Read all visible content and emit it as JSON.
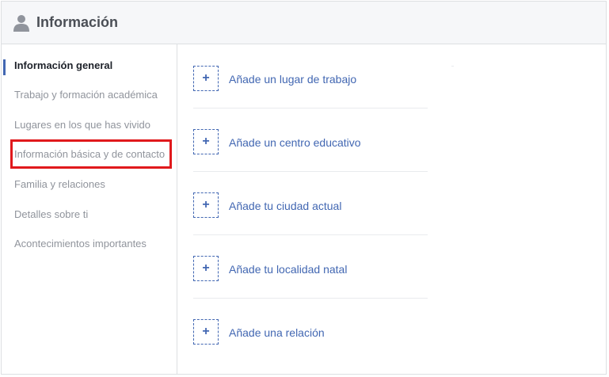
{
  "header": {
    "title": "Información",
    "icon": "person-icon"
  },
  "sidebar": {
    "items": [
      {
        "label": "Información general",
        "active": true
      },
      {
        "label": "Trabajo y formación académica",
        "active": false
      },
      {
        "label": "Lugares en los que has vivido",
        "active": false
      },
      {
        "label": "Información básica y de contacto",
        "active": false,
        "highlighted": true
      },
      {
        "label": "Familia y relaciones",
        "active": false
      },
      {
        "label": "Detalles sobre ti",
        "active": false
      },
      {
        "label": "Acontecimientos importantes",
        "active": false
      }
    ]
  },
  "main": {
    "add_items": [
      {
        "icon": "plus-icon",
        "label": "Añade un lugar de trabajo"
      },
      {
        "icon": "plus-icon",
        "label": "Añade un centro educativo"
      },
      {
        "icon": "plus-icon",
        "label": "Añade tu ciudad actual"
      },
      {
        "icon": "plus-icon",
        "label": "Añade tu localidad natal"
      },
      {
        "icon": "plus-icon",
        "label": "Añade una relación"
      }
    ]
  },
  "colors": {
    "link": "#4267b2",
    "highlight_border": "#e0191c",
    "active_indicator": "#4267b2"
  }
}
